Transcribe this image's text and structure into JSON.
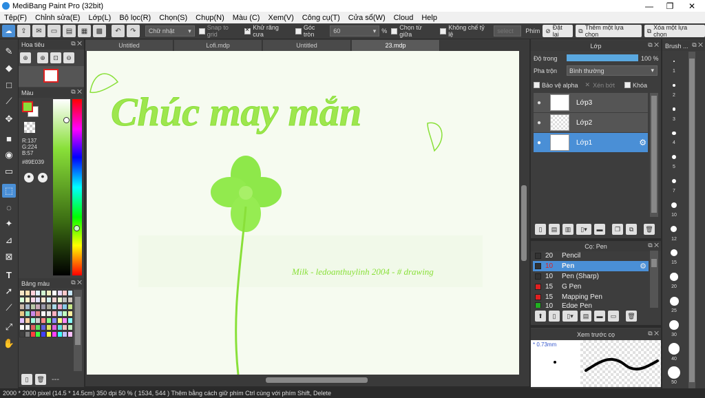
{
  "app": {
    "title": "MediBang Paint Pro (32bit)"
  },
  "window_controls": {
    "minimize": "—",
    "maximize": "❐",
    "close": "✕"
  },
  "menu": [
    "Tệp(F)",
    "Chỉnh sửa(E)",
    "Lớp(L)",
    "Bộ lọc(R)",
    "Chọn(S)",
    "Chụp(N)",
    "Màu (C)",
    "Xem(V)",
    "Công cụ(T)",
    "Cửa sổ(W)",
    "Cloud",
    "Help"
  ],
  "toolbar": {
    "shape_select": "Chữ nhật",
    "snap_to_grid": "Snap to grid",
    "antialias": "Khử răng cưa",
    "round_corner": "Góc tròn",
    "round_value": "60",
    "percent": "%",
    "select_center": "Chọn từ giữa",
    "no_ratio": "Không chế tỷ lệ",
    "select_placeholder": "select",
    "key_label": "Phím",
    "reset": "Đặt lại",
    "add_selection": "Thêm một lựa chọn",
    "remove_selection": "Xóa một lựa chọn"
  },
  "navigator": {
    "title": "Hoa tiêu"
  },
  "color": {
    "title": "Màu",
    "r": "R:137",
    "g": "G:224",
    "b": "B:57",
    "hex": "#89E039",
    "fg": "#89e039",
    "bg": "#ffffff"
  },
  "palette": {
    "title": "Bảng màu",
    "more": "---",
    "colors": [
      "#f5e6c8",
      "#ffe0b3",
      "#ffd1dc",
      "#e0f0ff",
      "#d0f5d0",
      "#f0f0c0",
      "#ffffff",
      "#e8d8f8",
      "#ffc8c8",
      "#c8e8ff",
      "#d8ffd8",
      "#fff0c8",
      "#f8d8e8",
      "#e0e0ff",
      "#ffe8d0",
      "#d0f0f0",
      "#f0d0d0",
      "#e8f8d0",
      "#c0c0c0",
      "#d0c8c0",
      "#c8b8a8",
      "#a8b8c8",
      "#b8c8a8",
      "#c8a8b8",
      "#9898a8",
      "#a8a898",
      "#a8d8e8",
      "#e8a8c8",
      "#88c8e8",
      "#c8e888",
      "#e8c888",
      "#88e8c8",
      "#c888e8",
      "#e88888",
      "#f8f8f8",
      "#e8e8e8",
      "#ffb0c0",
      "#b0e0ff",
      "#c0ffc0",
      "#fff0a0",
      "#e0c0ff",
      "#ffd0a0",
      "#a0ffe0",
      "#d0d0d0",
      "#ff8888",
      "#88ff88",
      "#8888ff",
      "#ffff88",
      "#ff88ff",
      "#88ffff",
      "#ffffff",
      "#f0f0f0",
      "#e06060",
      "#60e060",
      "#6060e0",
      "#e0e060",
      "#e060e0",
      "#60e0e0",
      "#f0c0c0",
      "#c0f0c0",
      "#404040",
      "#808080",
      "#ff4040",
      "#40ff40",
      "#4040ff",
      "#ffff40",
      "#ff40ff",
      "#40ffff",
      "#c0c0ff",
      "#ffc0ff"
    ]
  },
  "tabs": [
    "Untitled",
    "Lofi.mdp",
    "Untitled",
    "23.mdp"
  ],
  "canvas": {
    "title_text": "Chúc may mắn",
    "signature_text": "Milk - ledoanthuylinh 2004 - # drawing",
    "accent": "#89e039"
  },
  "layers": {
    "title": "Lớp",
    "opacity_label": "Độ trong",
    "opacity_value": "100 %",
    "opacity_fraction": 1.0,
    "blend_label": "Pha trộn",
    "blend_value": "Bình thường",
    "protect_alpha": "Bảo vệ alpha",
    "clipping": "Xén bớt",
    "lock": "Khóa",
    "items": [
      {
        "name": "Lớp3",
        "selected": false
      },
      {
        "name": "Lớp2",
        "selected": false
      },
      {
        "name": "Lớp1",
        "selected": true
      }
    ]
  },
  "brushes": {
    "title": "Cọ: Pen",
    "items": [
      {
        "size": "20",
        "name": "Pencil",
        "color": "#333333",
        "selected": false
      },
      {
        "size": "10",
        "name": "Pen",
        "color": "#333333",
        "selected": true
      },
      {
        "size": "10",
        "name": "Pen (Sharp)",
        "color": "#333333",
        "selected": false
      },
      {
        "size": "15",
        "name": "G Pen",
        "color": "#e02020",
        "selected": false
      },
      {
        "size": "15",
        "name": "Mapping Pen",
        "color": "#e02020",
        "selected": false
      },
      {
        "size": "10",
        "name": "Edge Pen",
        "color": "#20b020",
        "selected": false
      }
    ]
  },
  "preview": {
    "title": "Xem trước cọ",
    "size": "* 0.73mm"
  },
  "brush_sizes": {
    "title": "Brush ...",
    "items": [
      "1",
      "2",
      "3",
      "4",
      "5",
      "7",
      "10",
      "12",
      "15",
      "20",
      "25",
      "30",
      "40",
      "50"
    ]
  },
  "status": {
    "text": "2000 * 2000 pixel   (14.5 * 14.5cm)   350 dpi   50 %   ( 1534, 544 )   Thêm bằng cách giữ phím Ctrl cùng với phím Shift, Delete"
  }
}
